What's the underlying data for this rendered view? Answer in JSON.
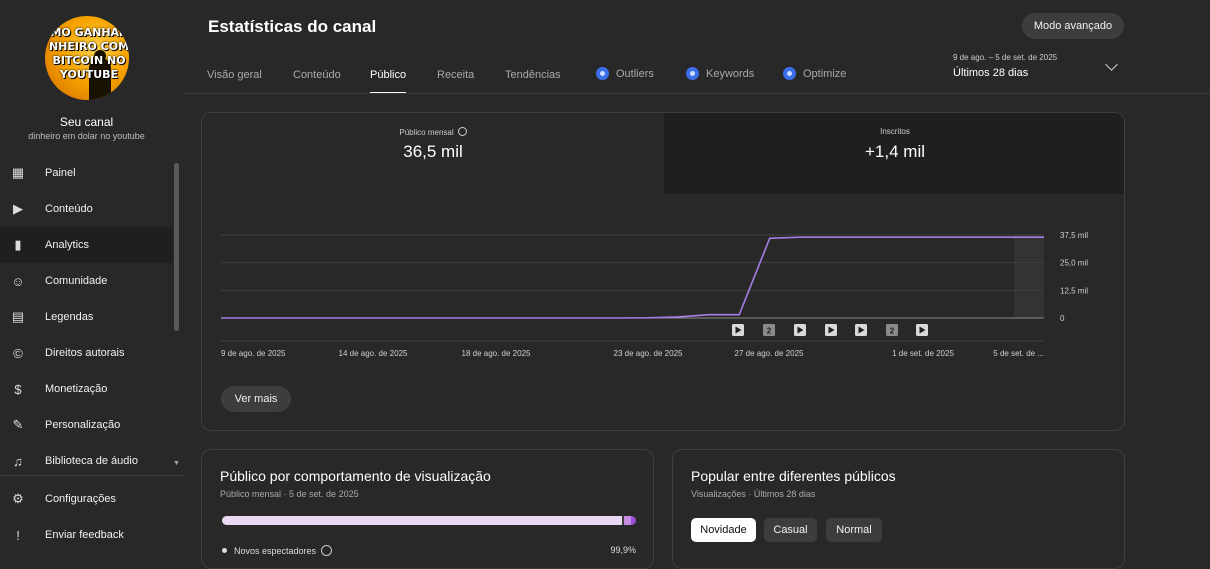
{
  "channel": {
    "avatar_text": "MO GANHAR\nNHEIRO COM\nBITCOIN NO\nYOUTUBE",
    "name": "Seu canal",
    "handle": "dinheiro em dolar no youtube"
  },
  "sidebar": {
    "items": [
      {
        "label": "Painel",
        "icon": "dashboard-icon",
        "glyph": "▦"
      },
      {
        "label": "Conteúdo",
        "icon": "content-icon",
        "glyph": "▶"
      },
      {
        "label": "Analytics",
        "icon": "analytics-icon",
        "glyph": "▮",
        "active": true
      },
      {
        "label": "Comunidade",
        "icon": "community-icon",
        "glyph": "☺"
      },
      {
        "label": "Legendas",
        "icon": "subtitles-icon",
        "glyph": "▤"
      },
      {
        "label": "Direitos autorais",
        "icon": "copyright-icon",
        "glyph": "©"
      },
      {
        "label": "Monetização",
        "icon": "monetization-icon",
        "glyph": "$"
      },
      {
        "label": "Personalização",
        "icon": "customization-icon",
        "glyph": "✎"
      },
      {
        "label": "Biblioteca de áudio",
        "icon": "audio-library-icon",
        "glyph": "♫"
      }
    ],
    "bottom_items": [
      {
        "label": "Configurações",
        "icon": "gear-icon",
        "glyph": "⚙"
      },
      {
        "label": "Enviar feedback",
        "icon": "feedback-icon",
        "glyph": "!"
      }
    ]
  },
  "header": {
    "title": "Estatísticas do canal",
    "advanced_mode": "Modo avançado",
    "date_range_small": "9 de ago. – 5 de set. de 2025",
    "date_range_label": "Últimos 28 dias"
  },
  "tabs": [
    {
      "label": "Visão geral"
    },
    {
      "label": "Conteúdo"
    },
    {
      "label": "Público",
      "active": true
    },
    {
      "label": "Receita"
    },
    {
      "label": "Tendências"
    },
    {
      "label": "Outliers",
      "ext": true
    },
    {
      "label": "Keywords",
      "ext": true
    },
    {
      "label": "Optimize",
      "ext": true
    }
  ],
  "metrics": {
    "monthly_audience_label": "Público mensal",
    "monthly_audience_value": "36,5 mil",
    "subscribers_label": "Inscritos",
    "subscribers_value": "+1,4 mil"
  },
  "chart_data": {
    "type": "line",
    "x": [
      "9 de ago. de 2025",
      "10 de ago.",
      "11 de ago.",
      "12 de ago.",
      "13 de ago.",
      "14 de ago. de 2025",
      "15 de ago.",
      "16 de ago.",
      "17 de ago.",
      "18 de ago. de 2025",
      "19 de ago.",
      "20 de ago.",
      "21 de ago.",
      "22 de ago.",
      "23 de ago. de 2025",
      "24 de ago.",
      "25 de ago.",
      "26 de ago.",
      "27 de ago. de 2025",
      "28 de ago.",
      "29 de ago.",
      "30 de ago.",
      "31 de ago.",
      "1 de set. de 2025",
      "2 de set.",
      "3 de set.",
      "4 de set.",
      "5 de set. de 2025"
    ],
    "values": [
      0,
      0,
      0,
      0,
      0,
      0,
      0,
      0,
      0,
      0,
      0,
      0,
      0,
      0,
      100,
      500,
      1500,
      1500,
      36000,
      36500,
      36500,
      36500,
      36500,
      36500,
      36500,
      36500,
      36500,
      36500
    ],
    "xtick_labels": [
      "9 de ago. de 2025",
      "14 de ago. de 2025",
      "18 de ago. de 2025",
      "23 de ago. de 2025",
      "27 de ago. de 2025",
      "1 de set. de 2025",
      "5 de set. de ..."
    ],
    "ytick_labels": [
      "37,5 mil",
      "25,0 mil",
      "12,5 mil",
      "0"
    ],
    "yticks": [
      37500,
      25000,
      12500,
      0
    ],
    "ylim": [
      0,
      37500
    ],
    "line_color": "#a67ce6",
    "markers": [
      "play",
      "2",
      "play",
      "play",
      "play",
      "2",
      "play"
    ],
    "grid": true
  },
  "buttons": {
    "see_more": "Ver mais"
  },
  "audience_behavior": {
    "title": "Público por comportamento de visualização",
    "subtitle": "Público mensal · 5 de set. de 2025",
    "new_viewers_fraction": 0.967,
    "casual_fraction": 0.022,
    "regular_fraction": 0.011,
    "new_viewers_label": "Novos espectadores",
    "new_viewers_pct": "99,9%"
  },
  "popular": {
    "title": "Popular entre diferentes públicos",
    "subtitle": "Visualizações · Últimos 28 dias",
    "chips": [
      {
        "label": "Novidade",
        "selected": true
      },
      {
        "label": "Casual"
      },
      {
        "label": "Normal"
      }
    ]
  }
}
